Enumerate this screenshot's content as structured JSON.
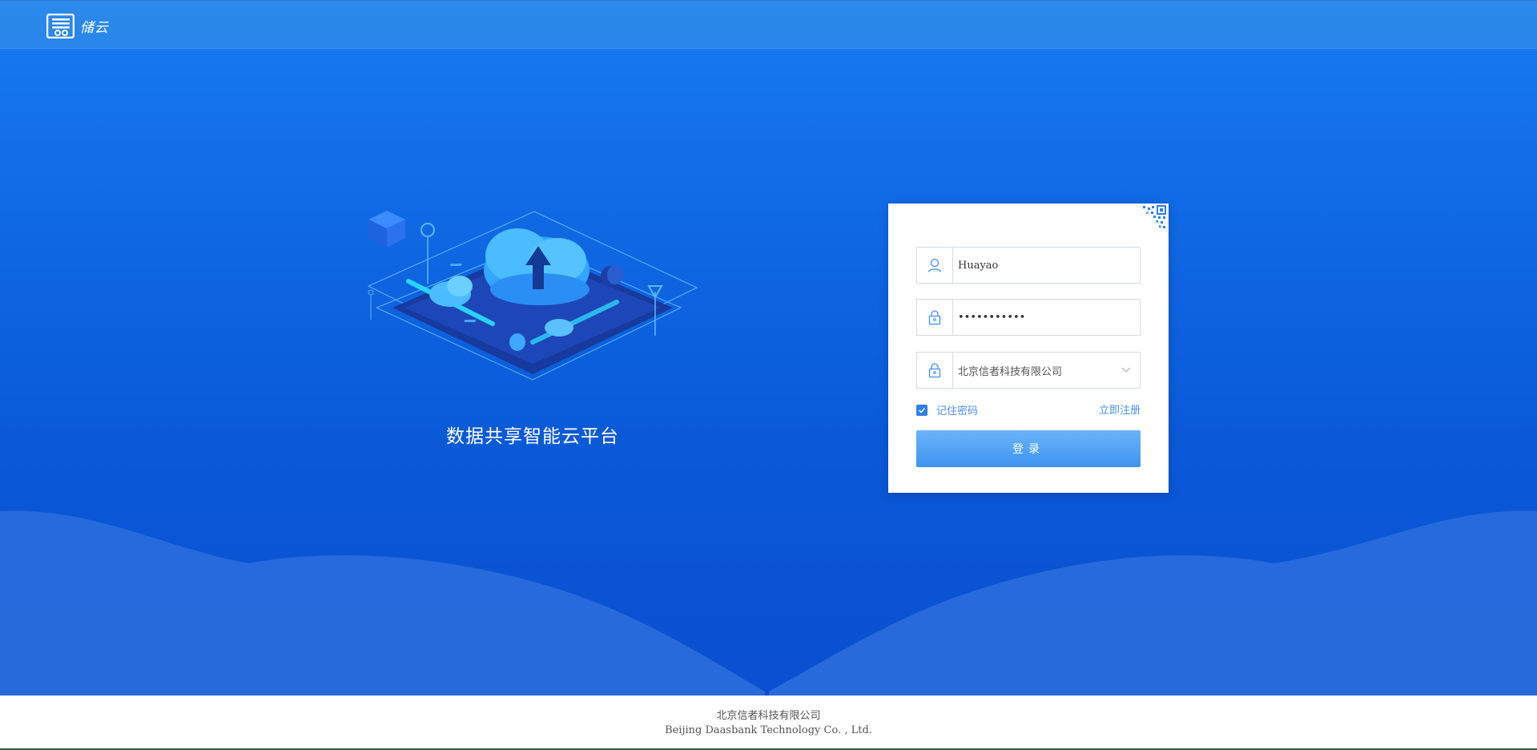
{
  "header": {
    "logo_text": "储云",
    "logo_icon": "stacked-disk-logo-icon"
  },
  "hero": {
    "slogan": "数据共享智能云平台",
    "illustration": "isometric-cloud-upload-illustration"
  },
  "login": {
    "username": {
      "value": "Huayao",
      "icon": "user-icon"
    },
    "password": {
      "value": "•••••••••••",
      "icon": "lock-icon"
    },
    "company": {
      "value": "北京信者科技有限公司",
      "icon": "lock-icon"
    },
    "remember_label": "记住密码",
    "remember_checked": true,
    "register_label": "立即注册",
    "submit_label": "登录",
    "qr_icon": "qr-code-icon"
  },
  "footer": {
    "company_cn": "北京信者科技有限公司",
    "company_en": "Beijing Daasbank Technology Co. , Ltd."
  },
  "colors": {
    "topbar": "#2c8aec",
    "background": "#0a5ad8",
    "accent": "#2f7fe8",
    "link": "#4a8fe6",
    "button_top": "#6ab4fb",
    "button_bottom": "#3f92ef"
  }
}
